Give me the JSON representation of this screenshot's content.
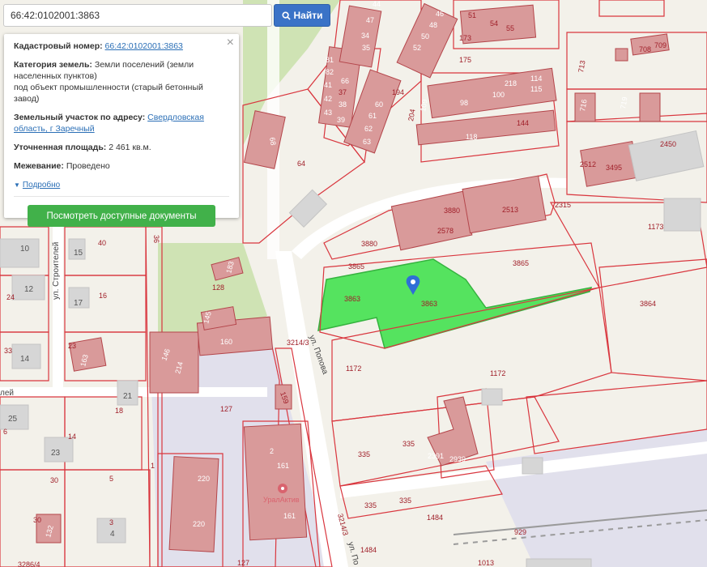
{
  "search": {
    "value": "66:42:0102001:3863",
    "button_label": "Найти"
  },
  "info": {
    "cadastral_label": "Кадастровый номер:",
    "cadastral_value": "66:42:0102001:3863",
    "category_label": "Категория земель:",
    "category_value": "Земли поселений (земли населенных пунктов)",
    "category_purpose": "под объект промышленности (старый бетонный завод)",
    "address_label": "Земельный участок по адресу:",
    "address_value": "Свердловская область, г Заречный",
    "area_label": "Уточненная площадь:",
    "area_value": "2 461 кв.м.",
    "survey_label": "Межевание:",
    "survey_value": "Проведено",
    "expand_label": "Подробно",
    "docs_button": "Посмотреть доступные документы",
    "close_icon": "close-icon"
  },
  "streets": {
    "popova_1": "ул. Попова",
    "popova_2": "ул. По",
    "stroiteley": "ул. Строителей",
    "partial_left": "лей"
  },
  "poi": {
    "name": "УралАктив",
    "icon": "map-pin-icon"
  },
  "selected_parcel": {
    "label": "3863",
    "color": "#55e35f"
  },
  "plot_labels": {
    "p3863a": "3863",
    "p3863b": "3863",
    "p3865a": "3865",
    "p3865b": "3865",
    "p3880a": "3880",
    "p3880b": "3880",
    "p2578": "2578",
    "p2513": "2513",
    "p2315": "2315",
    "p1173": "1173",
    "p3864": "3864",
    "p2450": "2450",
    "p2512": "2512",
    "p3495": "3495",
    "p1172a": "1172",
    "p1172b": "1172",
    "p335a": "335",
    "p335b": "335",
    "p335c": "335",
    "p335d": "335",
    "p2391": "2391",
    "p2939": "2939",
    "p1484a": "1484",
    "p1484b": "1484",
    "p929": "929",
    "p1013": "1013",
    "p3214a": "3214/3",
    "p3214b": "3214/3",
    "p127a": "127",
    "p127b": "127",
    "p161a": "161",
    "p161b": "161",
    "p2": "2",
    "p220a": "220",
    "p220b": "220",
    "p159": "159",
    "p160": "160",
    "p214": "214",
    "p146": "146",
    "p145": "145",
    "p128": "128",
    "p183": "183",
    "p64": "64",
    "p68": "68",
    "p36": "36",
    "p40": "40",
    "p16": "16",
    "p10": "10",
    "p15": "15",
    "p12": "12",
    "p24": "24",
    "p17": "17",
    "p33": "33",
    "p14": "14",
    "p23a": "23",
    "p23b": "23",
    "p163": "163",
    "p21": "21",
    "p18": "18",
    "p25": "25",
    "p14b": "14",
    "p30a": "30",
    "p30b": "30",
    "p132": "132",
    "p4": "4",
    "p1": "1",
    "p5": "5",
    "p3": "3",
    "p6": "6",
    "p3286": "3286/4",
    "n708": "708",
    "n709": "709",
    "n713": "713",
    "n716": "716",
    "n719": "719",
    "n51": "51",
    "n54": "54",
    "n55": "55",
    "n173": "173",
    "n175": "175",
    "n46": "46",
    "n48": "48",
    "n50": "50",
    "n52": "52",
    "n60": "60",
    "n61": "61",
    "n62": "62",
    "n63": "63",
    "n109": "109",
    "n98": "98",
    "n100": "100",
    "n218": "218",
    "n114": "114",
    "n115": "115",
    "n118": "118",
    "n144": "144",
    "n194": "194",
    "n204": "204",
    "n34": "34",
    "n35": "35",
    "n37": "37",
    "n38": "38",
    "n39": "39",
    "n66": "66",
    "n81": "81",
    "n82": "82",
    "n41": "41",
    "n42": "42",
    "n43": "43",
    "n44": "44",
    "n47": "47"
  }
}
